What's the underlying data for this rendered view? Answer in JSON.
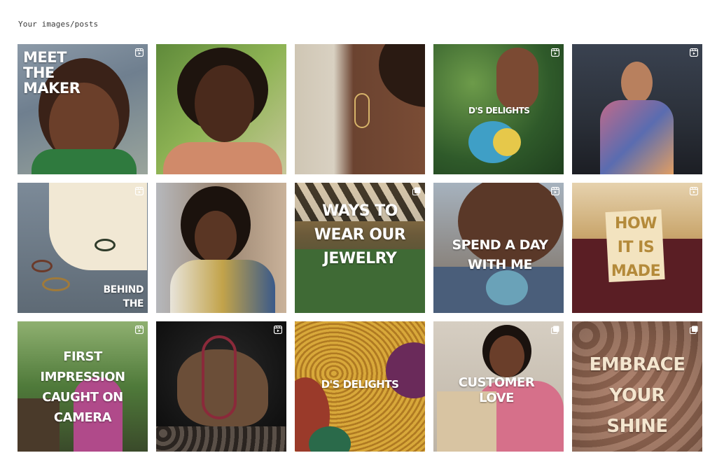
{
  "header": {
    "title": "Your images/posts"
  },
  "posts": [
    {
      "overlay": "MEET THE MAKER",
      "type": "reel",
      "type_icon": "reel-icon"
    },
    {
      "overlay": "",
      "type": "image",
      "type_icon": ""
    },
    {
      "overlay": "",
      "type": "image",
      "type_icon": ""
    },
    {
      "overlay": "D'S DELIGHTS",
      "type": "reel",
      "type_icon": "reel-icon"
    },
    {
      "overlay": "",
      "type": "reel",
      "type_icon": "reel-icon"
    },
    {
      "overlay": "BEHIND THE SCENES",
      "type": "reel",
      "type_icon": "reel-icon"
    },
    {
      "overlay": "",
      "type": "image",
      "type_icon": ""
    },
    {
      "overlay": "WAYS TO WEAR OUR JEWELRY",
      "type": "carousel",
      "type_icon": "carousel-icon"
    },
    {
      "overlay": "SPEND A DAY WITH ME",
      "type": "reel",
      "type_icon": "reel-icon"
    },
    {
      "overlay": "HOW IT IS MADE",
      "type": "reel",
      "type_icon": "reel-icon"
    },
    {
      "overlay": "FIRST IMPRESSION CAUGHT ON CAMERA",
      "type": "reel",
      "type_icon": "reel-icon"
    },
    {
      "overlay": "",
      "type": "reel",
      "type_icon": "reel-icon"
    },
    {
      "overlay": "D'S DELIGHTS",
      "type": "image",
      "type_icon": ""
    },
    {
      "overlay": "CUSTOMER LOVE",
      "type": "carousel",
      "type_icon": "carousel-icon"
    },
    {
      "overlay": "EMBRACE YOUR SHINE",
      "type": "carousel",
      "type_icon": "carousel-icon"
    }
  ],
  "colors": {
    "overlay_text": "#ffffff",
    "how_made_badge": "#f3e3bf",
    "how_made_text": "#b48a3a"
  }
}
